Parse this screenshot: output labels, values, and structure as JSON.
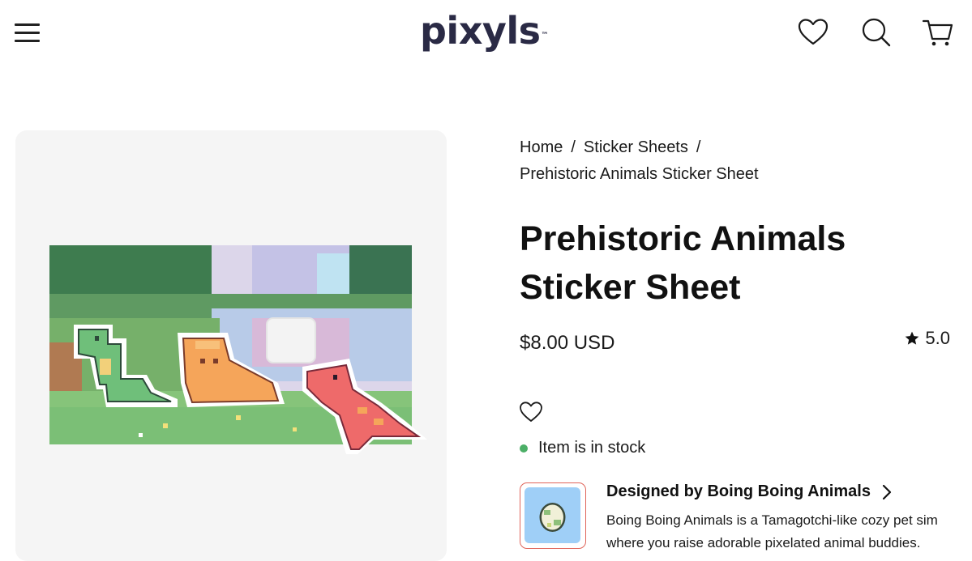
{
  "header": {
    "logo_text": "pixyls",
    "logo_mark": "™",
    "menu_icon": "hamburger-menu-icon",
    "wishlist_icon": "heart-icon",
    "search_icon": "search-icon",
    "cart_icon": "cart-icon"
  },
  "breadcrumb": {
    "home": "Home",
    "category": "Sticker Sheets",
    "separator": "/",
    "current": "Prehistoric Animals Sticker Sheet"
  },
  "product": {
    "title_line1": "Prehistoric Animals",
    "title_line2": "Sticker Sheet",
    "price": "$8.00 USD",
    "rating": "5.0",
    "rating_icon": "star-icon",
    "wishlist_icon": "heart-outline-icon",
    "stock_text": "Item is in stock",
    "stock_color": "#4caf67",
    "image_description_icon": "pixel-dinosaur-sticker-sheet-image"
  },
  "designer": {
    "label": "Designed by Boing Boing Animals",
    "description": "Boing Boing Animals is a Tamagotchi-like cozy pet sim where you raise adorable pixelated animal buddies.",
    "thumb_icon": "egg-avatar-icon",
    "accent_color": "#e0655a"
  },
  "colors": {
    "text": "#111111",
    "logo": "#2a2a45",
    "card_bg": "#f5f5f5"
  }
}
